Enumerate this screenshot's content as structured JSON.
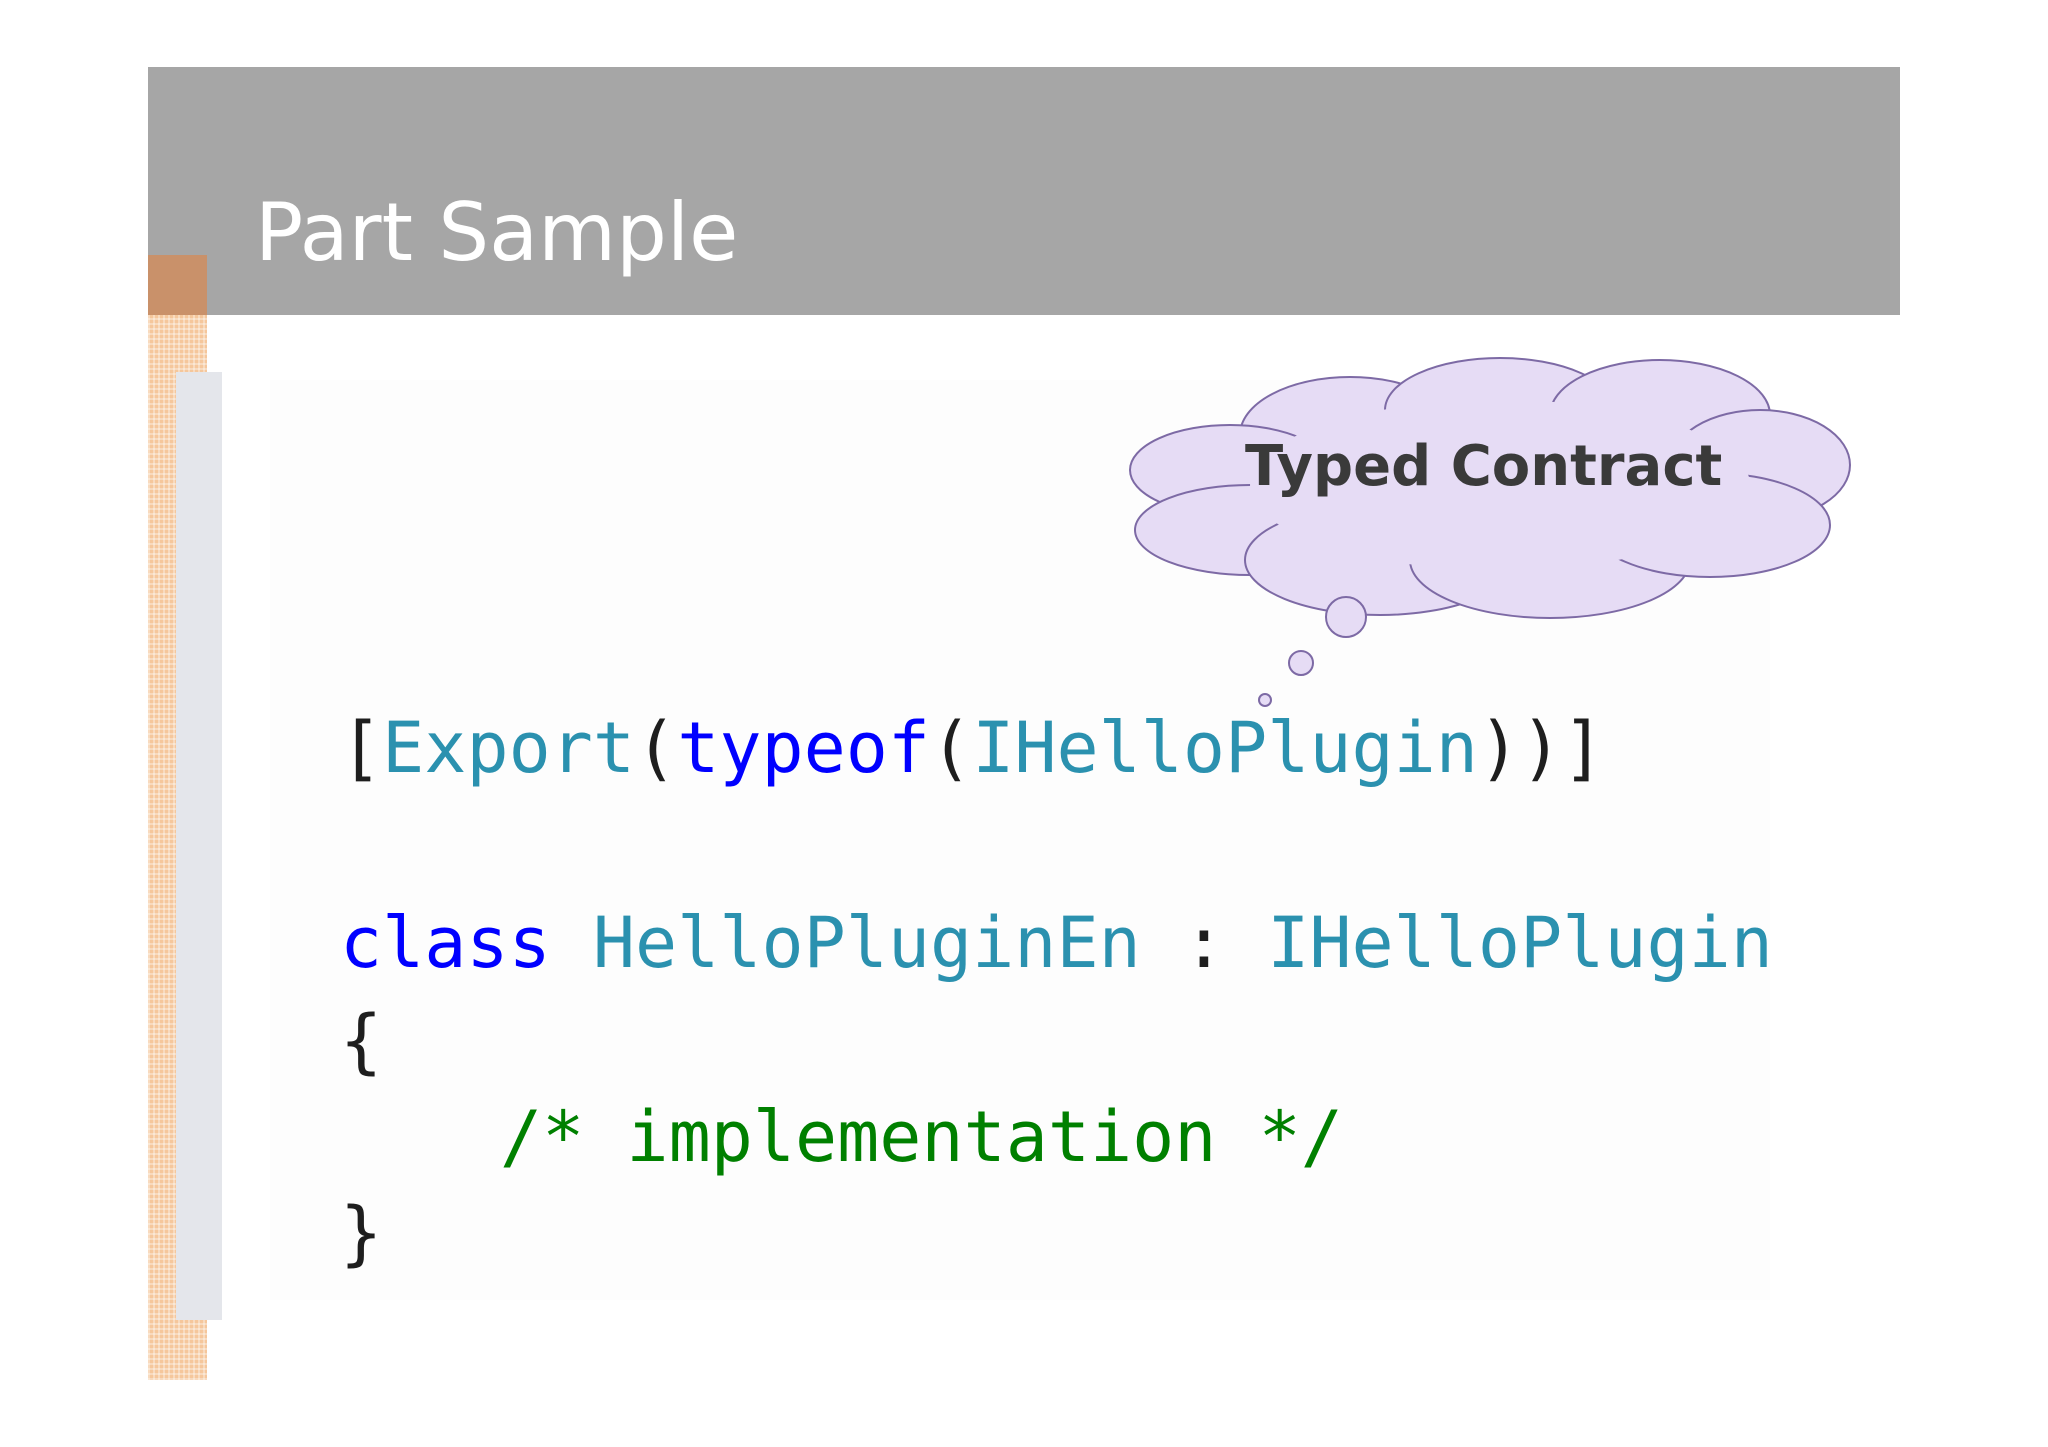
{
  "slide": {
    "title": "Part Sample"
  },
  "callout": {
    "text": "Typed Contract",
    "fill_color": "#e6dcf5",
    "stroke_color": "#7d6aa5"
  },
  "code": {
    "line1": {
      "open_bracket": "[",
      "attribute": "Export",
      "open_paren1": "(",
      "keyword": "typeof",
      "open_paren2": "(",
      "type": "IHelloPlugin",
      "close": "))]"
    },
    "line2": {
      "keyword": "class",
      "class_name": "HelloPluginEn",
      "separator": ":",
      "interface": "IHelloPlugin"
    },
    "line3": {
      "brace": "{"
    },
    "line4": {
      "comment": "/* implementation */"
    },
    "line5": {
      "brace": "}"
    }
  },
  "colors": {
    "title_bar": "#a6a6a6",
    "accent": "#f5c79c",
    "type_color": "#2b91af",
    "keyword_color": "#0000ff",
    "comment_color": "#008000"
  }
}
